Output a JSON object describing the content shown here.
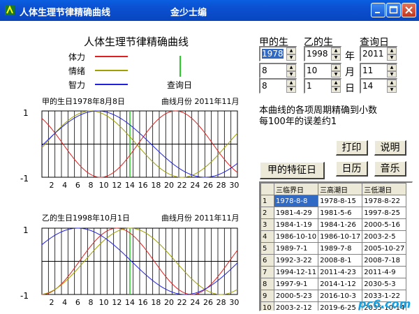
{
  "window": {
    "title": "人体生理节律精确曲线",
    "subtitle": "金少士编"
  },
  "legend": {
    "heading": "人体生理节律精确曲线",
    "items": [
      {
        "label": "体力",
        "color": "#e02020"
      },
      {
        "label": "情绪",
        "color": "#a0a000"
      },
      {
        "label": "智力",
        "color": "#2020e0"
      }
    ],
    "query_label": "查询日",
    "query_color": "#22cc22"
  },
  "chart_a": {
    "birth_label": "甲的生日1978年8月8日",
    "month_label": "曲线月份 2011年11月",
    "y_top": "1",
    "y_bottom": "-1"
  },
  "chart_b": {
    "birth_label": "乙的生日1998年10月1日",
    "month_label": "曲线月份 2011年11月",
    "y_top": "1",
    "y_bottom": "-1"
  },
  "chart_data": [
    {
      "type": "line",
      "title": "甲的生日1978年8月8日",
      "x": [
        1,
        2,
        3,
        4,
        5,
        6,
        7,
        8,
        9,
        10,
        11,
        12,
        13,
        14,
        15,
        16,
        17,
        18,
        19,
        20,
        21,
        22,
        23,
        24,
        25,
        26,
        27,
        28,
        29,
        30
      ],
      "xticks": [
        "2",
        "4",
        "6",
        "8",
        "10",
        "12",
        "14",
        "16",
        "18",
        "20",
        "22",
        "24",
        "26",
        "28",
        "30"
      ],
      "ylim": [
        -1,
        1
      ],
      "series": [
        {
          "name": "体力",
          "period": 23,
          "peak_day": 21
        },
        {
          "name": "情绪",
          "period": 28,
          "peak_day": 8
        },
        {
          "name": "智力",
          "period": 33,
          "peak_day": 9
        }
      ],
      "query_day": 14
    },
    {
      "type": "line",
      "title": "乙的生日1998年10月1日",
      "x": [
        1,
        2,
        3,
        4,
        5,
        6,
        7,
        8,
        9,
        10,
        11,
        12,
        13,
        14,
        15,
        16,
        17,
        18,
        19,
        20,
        21,
        22,
        23,
        24,
        25,
        26,
        27,
        28,
        29,
        30
      ],
      "xticks": [
        "2",
        "4",
        "6",
        "8",
        "10",
        "12",
        "14",
        "16",
        "18",
        "20",
        "22",
        "24",
        "26",
        "28",
        "30"
      ],
      "ylim": [
        -1,
        1
      ],
      "series": [
        {
          "name": "体力",
          "period": 23,
          "peak_day": 12
        },
        {
          "name": "情绪",
          "period": 28,
          "peak_day": 14
        },
        {
          "name": "智力",
          "period": 33,
          "peak_day": 6
        }
      ],
      "query_day": 14
    }
  ],
  "inputs": {
    "jia_label": "甲的生",
    "yi_label": "乙的生",
    "query_label": "查询日",
    "jia": [
      "1978",
      "8",
      "8"
    ],
    "yi": [
      "1998",
      "10",
      "1"
    ],
    "query": [
      "2011",
      "11",
      "14"
    ],
    "ymd": [
      "年",
      "月",
      "日"
    ]
  },
  "note": {
    "line1": "本曲线的各项周期精确到小数",
    "line2": "每100年的误差约1"
  },
  "buttons": {
    "print": "打印",
    "help": "说明",
    "calendar": "日历",
    "music": "音乐",
    "feature_day": "甲的特征日"
  },
  "table": {
    "headers": [
      "三临界日",
      "三高潮日",
      "三低潮日"
    ],
    "rows": [
      [
        "1",
        "1978-8-8",
        "1978-8-15",
        "1978-8-22"
      ],
      [
        "2",
        "1981-4-29",
        "1981-5-6",
        "1997-8-25"
      ],
      [
        "3",
        "1984-1-19",
        "1984-1-26",
        "2000-5-16"
      ],
      [
        "4",
        "1986-10-10",
        "1986-10-17",
        "2003-2-5"
      ],
      [
        "5",
        "1989-7-1",
        "1989-7-8",
        "2005-10-27"
      ],
      [
        "6",
        "1992-3-22",
        "2008-8-1",
        "2008-7-18"
      ],
      [
        "7",
        "1994-12-11",
        "2011-4-23",
        "2011-4-9"
      ],
      [
        "8",
        "1997-9-1",
        "2014-1-12",
        "2030-5-3"
      ],
      [
        "9",
        "2000-5-23",
        "2016-10-3",
        "2033-1-22"
      ],
      [
        "10",
        "2003-2-12",
        "2019-6-25",
        "2035-10-14"
      ]
    ]
  },
  "watermark": "pc6.com"
}
